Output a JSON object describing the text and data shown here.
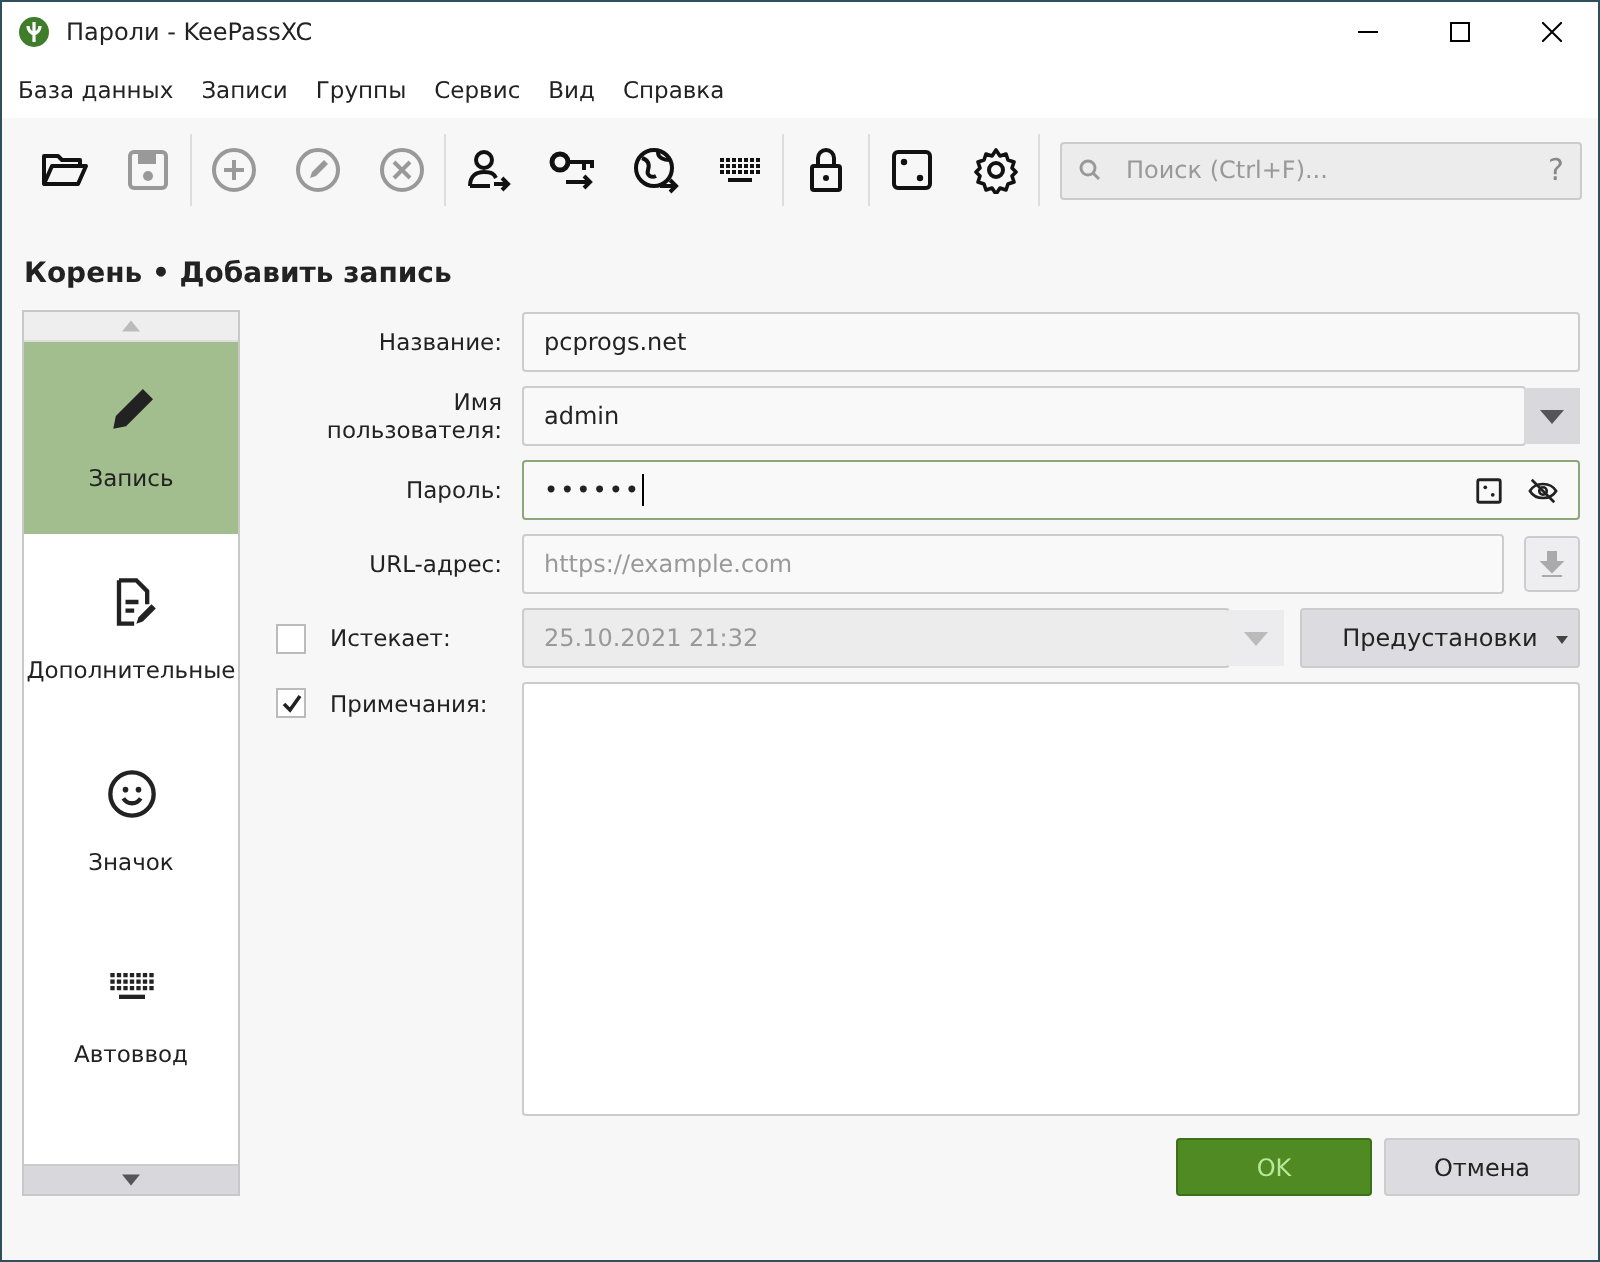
{
  "window": {
    "title": "Пароли - KeePassXC"
  },
  "menu": [
    "База данных",
    "Записи",
    "Группы",
    "Сервис",
    "Вид",
    "Справка"
  ],
  "toolbar": [
    [
      {
        "kind": "open",
        "disabled": false
      },
      {
        "kind": "save",
        "disabled": true
      }
    ],
    [
      {
        "kind": "add",
        "disabled": true
      },
      {
        "kind": "edit",
        "disabled": true
      },
      {
        "kind": "delete",
        "disabled": true
      }
    ],
    [
      {
        "kind": "user",
        "disabled": false
      },
      {
        "kind": "key",
        "disabled": false
      },
      {
        "kind": "globe",
        "disabled": false
      },
      {
        "kind": "keyboard",
        "disabled": false
      }
    ],
    [
      {
        "kind": "lock",
        "disabled": false
      }
    ],
    [
      {
        "kind": "dice",
        "disabled": false
      },
      {
        "kind": "settings",
        "disabled": false
      }
    ]
  ],
  "search": {
    "placeholder": "Поиск (Ctrl+F)...",
    "help": "?"
  },
  "heading": "Корень • Добавить запись",
  "sidebar": {
    "items": [
      {
        "kind": "entry",
        "label": "Запись",
        "selected": true
      },
      {
        "kind": "advanced",
        "label": "Дополнительные",
        "selected": false
      },
      {
        "kind": "icon",
        "label": "Значок",
        "selected": false
      },
      {
        "kind": "autotype",
        "label": "Автоввод",
        "selected": false
      }
    ]
  },
  "form": {
    "title": {
      "label": "Название:",
      "value": "pcprogs.net"
    },
    "username": {
      "label": "Имя пользователя:",
      "value": "admin"
    },
    "password": {
      "label": "Пароль:",
      "value": "••••••"
    },
    "url": {
      "label": "URL-адрес:",
      "placeholder": "https://example.com"
    },
    "expires": {
      "label": "Истекает:",
      "checked": false,
      "value": "25.10.2021 21:32",
      "presets": "Предустановки"
    },
    "notes": {
      "label": "Примечания:",
      "checked": true
    }
  },
  "buttons": [
    {
      "label": "OK",
      "kind": "primary"
    },
    {
      "label": "Отмена",
      "kind": "secondary"
    }
  ]
}
